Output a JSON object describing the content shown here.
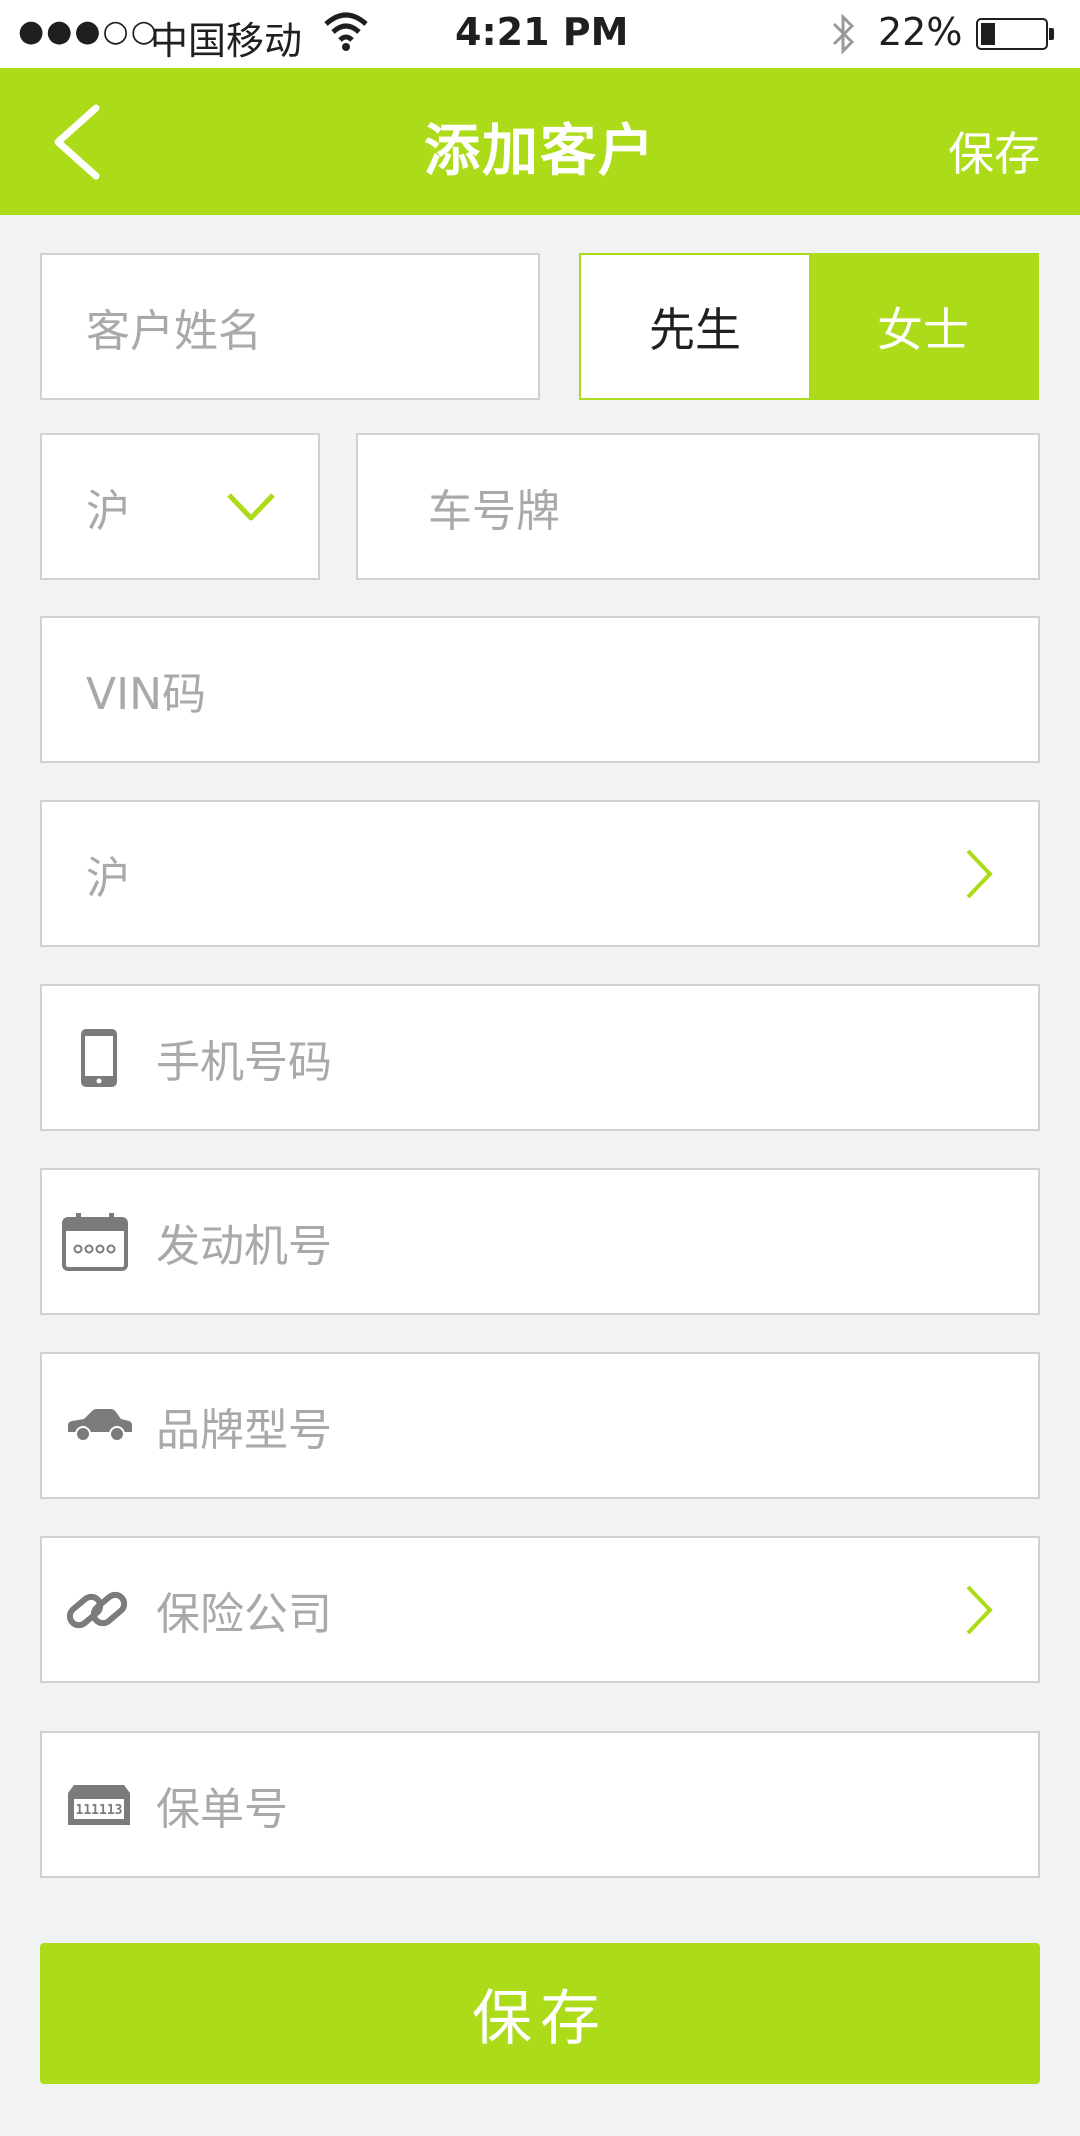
{
  "status_bar": {
    "signal": "●●●○○",
    "carrier": "中国移动",
    "time": "4:21 PM",
    "battery": "22%"
  },
  "nav": {
    "title": "添加客户",
    "save": "保存"
  },
  "form": {
    "name_placeholder": "客户姓名",
    "gender_options": [
      "先生",
      "女士"
    ],
    "gender_selected": "女士",
    "plate_region": "沪",
    "plate_placeholder": "车号牌",
    "vin_placeholder": "VIN码",
    "region_select": "沪",
    "phone_placeholder": "手机号码",
    "engine_placeholder": "发动机号",
    "model_placeholder": "品牌型号",
    "insurer_placeholder": "保险公司",
    "policy_placeholder": "保单号",
    "policy_icon_text": "111113"
  },
  "footer": {
    "save_button": "保存"
  },
  "colors": {
    "accent": "#acdb19",
    "background": "#f1f2f4",
    "placeholder": "#a9a9a9",
    "icon": "#7b7b7b"
  },
  "icons": [
    "back-icon",
    "wifi-icon",
    "bluetooth-icon",
    "battery-icon",
    "dropdown-chevron-icon",
    "chevron-right-icon",
    "mobile-phone-icon",
    "calendar-icon",
    "car-icon",
    "link-icon",
    "ticket-icon"
  ]
}
